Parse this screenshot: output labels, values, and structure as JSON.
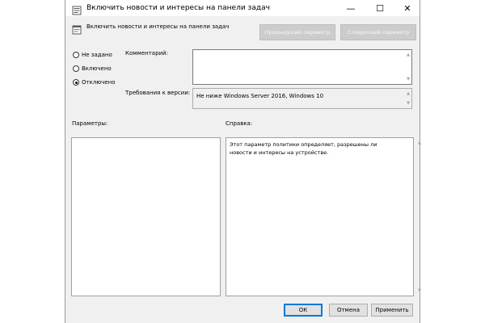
{
  "window": {
    "title": "Включить новости и интересы на панели задач",
    "minimize_glyph": "—",
    "maximize_glyph": "☐",
    "close_glyph": "✕"
  },
  "header": {
    "policy_name": "Включить новости и интересы на панели задач",
    "prev_button": "Предыдущий параметр",
    "next_button": "Следующий параметр"
  },
  "state": {
    "options": [
      {
        "label": "Не задано",
        "checked": false
      },
      {
        "label": "Включено",
        "checked": false
      },
      {
        "label": "Отключено",
        "checked": true
      }
    ]
  },
  "comment": {
    "label": "Комментарий:",
    "value": ""
  },
  "supported": {
    "label": "Требования к версии:",
    "value": "Не ниже Windows Server 2016, Windows 10"
  },
  "options_panel": {
    "label": "Параметры:"
  },
  "help_panel": {
    "label": "Справка:",
    "text": "Этот параметр политики определяет, разрешены ли новости и интересы на устройстве."
  },
  "buttons": {
    "ok": "ОК",
    "cancel": "Отмена",
    "apply": "Применить"
  },
  "icons": {
    "title_icon": "policy-icon",
    "header_icon": "policy-setting-icon"
  },
  "colors": {
    "dialog_bg": "#f0f0f0",
    "default_button_border": "#0078d7"
  }
}
